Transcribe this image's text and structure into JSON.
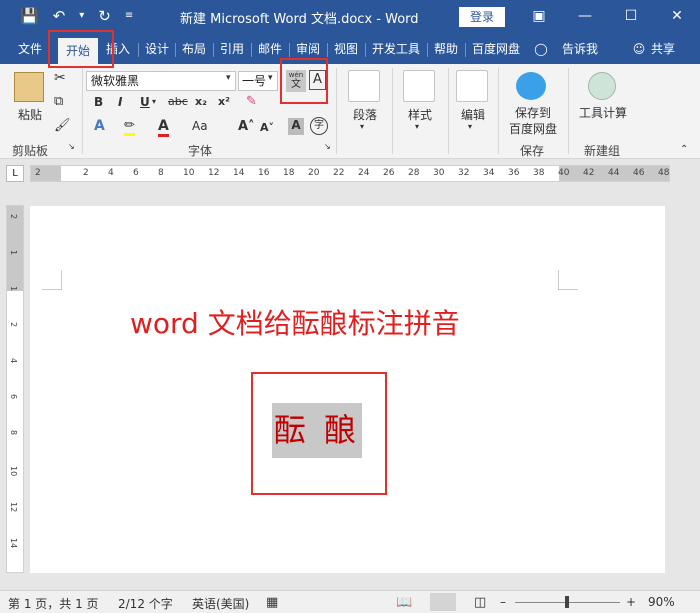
{
  "titlebar": {
    "save_icon": "save-icon",
    "undo_icon": "undo-icon",
    "redo_icon": "redo-icon",
    "doc_title": "新建 Microsoft Word 文档.docx  -  Word",
    "login": "登录",
    "accent": "#2b579a"
  },
  "tabs": {
    "file": "文件",
    "home": "开始",
    "insert": "插入",
    "design": "设计",
    "layout": "布局",
    "references": "引用",
    "mailings": "邮件",
    "review": "审阅",
    "view": "视图",
    "developer": "开发工具",
    "help": "帮助",
    "baidu": "百度网盘",
    "tell": "告诉我",
    "share": "共享"
  },
  "ribbon": {
    "paste": "粘贴",
    "clipboard": "剪贴板",
    "font_name": "微软雅黑",
    "font_size": "一号",
    "pinyin_top": "wén",
    "pinyin_bottom": "文",
    "font_group": "字体",
    "paragraph": "段落",
    "styles": "样式",
    "editing": "编辑",
    "save_to_top": "保存到",
    "save_to_bottom": "百度网盘",
    "save_group": "保存",
    "tool_calc": "工具计算",
    "new_group": "新建组"
  },
  "document": {
    "heading": "word 文档给酝酿标注拼音",
    "selected": "酝 酿",
    "text_color": "#e02020"
  },
  "ruler_ticks": [
    "2",
    "2",
    "4",
    "6",
    "8",
    "10",
    "12",
    "14",
    "16",
    "18",
    "20",
    "22",
    "24",
    "26",
    "28",
    "30",
    "32",
    "34",
    "36",
    "38",
    "40",
    "42",
    "44",
    "46",
    "48"
  ],
  "status": {
    "page": "第 1 页，共 1 页",
    "words": "2/12 个字",
    "language": "英语(美国)",
    "zoom": "90%"
  }
}
